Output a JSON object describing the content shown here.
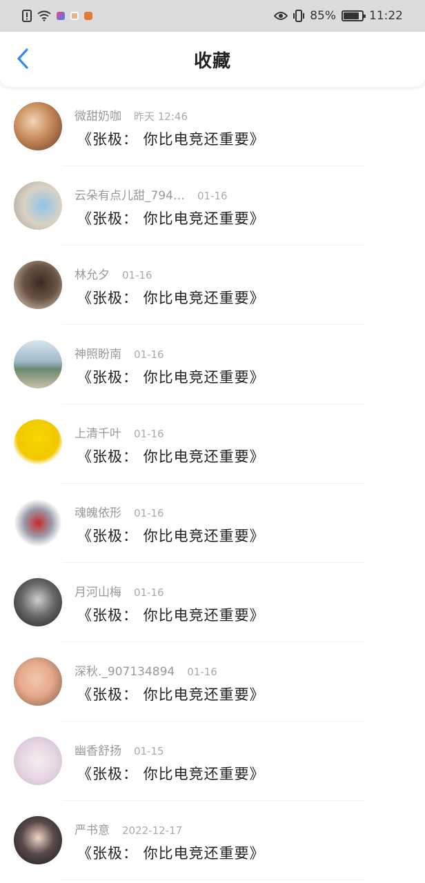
{
  "status_bar": {
    "battery_percent": "85%",
    "battery_level": 0.85,
    "time": "11:22",
    "icons": [
      "alert-icon",
      "wifi-icon",
      "app-notification-icon",
      "app-notification-icon",
      "app-notification-icon",
      "eye-icon",
      "vibrate-icon",
      "battery-icon"
    ]
  },
  "header": {
    "title": "收藏",
    "back_icon": "chevron-left-icon",
    "accent_color": "#2d8cf0"
  },
  "items": [
    {
      "name": "微甜奶咖",
      "time": "昨天 12:46",
      "content": "《张极： 你比电竞还重要》"
    },
    {
      "name": "云朵有点儿甜_794…",
      "time": "01-16",
      "content": "《张极： 你比电竞还重要》"
    },
    {
      "name": "林允夕",
      "time": "01-16",
      "content": "《张极： 你比电竞还重要》"
    },
    {
      "name": "神照盼南",
      "time": "01-16",
      "content": "《张极： 你比电竞还重要》"
    },
    {
      "name": "上清千叶",
      "time": "01-16",
      "content": "《张极： 你比电竞还重要》"
    },
    {
      "name": "魂魄依形",
      "time": "01-16",
      "content": "《张极： 你比电竞还重要》"
    },
    {
      "name": "月河山梅",
      "time": "01-16",
      "content": "《张极： 你比电竞还重要》"
    },
    {
      "name": "深秋._907134894",
      "time": "01-16",
      "content": "《张极： 你比电竞还重要》"
    },
    {
      "name": "幽香舒扬",
      "time": "01-15",
      "content": "《张极： 你比电竞还重要》"
    },
    {
      "name": "严书意",
      "time": "2022-12-17",
      "content": "《张极： 你比电竞还重要》"
    }
  ]
}
